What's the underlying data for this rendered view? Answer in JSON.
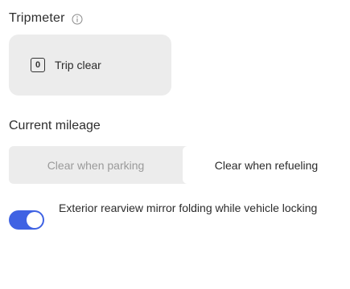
{
  "tripmeter": {
    "title": "Tripmeter",
    "info_icon": "info-icon",
    "trip_clear": {
      "icon_text": "0",
      "label": "Trip clear"
    }
  },
  "current_mileage": {
    "title": "Current mileage",
    "options": [
      {
        "label": "Clear when parking",
        "selected": false
      },
      {
        "label": "Clear when refueling",
        "selected": true
      }
    ]
  },
  "mirror_folding": {
    "label": "Exterior rearview mirror folding while vehicle locking",
    "enabled": true,
    "accent_color": "#3f62e3"
  }
}
